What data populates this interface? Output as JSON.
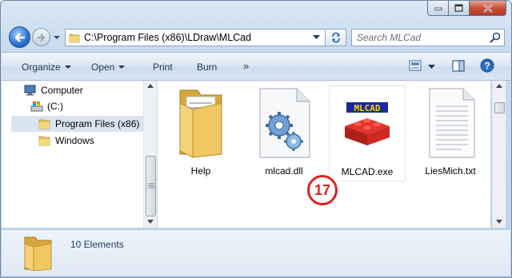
{
  "address": {
    "path": "C:\\Program Files (x86)\\LDraw\\MLCad",
    "search_placeholder": "Search MLCad"
  },
  "toolbar": {
    "organize": "Organize",
    "open": "Open",
    "print": "Print",
    "burn": "Burn",
    "more": "»"
  },
  "nav": {
    "items": [
      {
        "label": "Computer",
        "icon": "computer-icon"
      },
      {
        "label": "(C:)",
        "icon": "drive-icon"
      },
      {
        "label": "Program Files (x86)",
        "icon": "folder-icon",
        "selected": true
      },
      {
        "label": "Windows",
        "icon": "folder-icon"
      }
    ]
  },
  "files": [
    {
      "label": "Help",
      "icon": "folder-open-icon"
    },
    {
      "label": "mlcad.dll",
      "icon": "dll-gears-icon"
    },
    {
      "label": "MLCAD.exe",
      "icon": "mlcad-brick-icon"
    },
    {
      "label": "LiesMich.txt",
      "icon": "text-file-icon"
    }
  ],
  "badge": {
    "text": "17",
    "color": "#e02020"
  },
  "details": {
    "count_text": "10 Elements"
  },
  "colors": {
    "accent": "#1e395b",
    "close_button": "#c7503a",
    "selection": "#d9e4f1"
  }
}
